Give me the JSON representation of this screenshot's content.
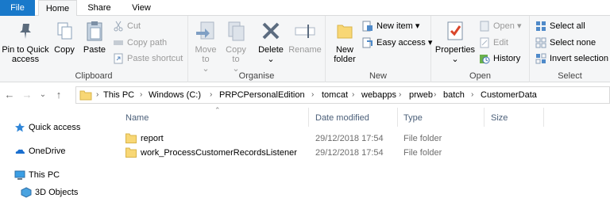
{
  "ribbon_tabs": {
    "file": "File",
    "home": "Home",
    "share": "Share",
    "view": "View"
  },
  "clipboard": {
    "pin": "Pin to Quick access",
    "copy": "Copy",
    "paste": "Paste",
    "cut": "Cut",
    "copy_path": "Copy path",
    "paste_shortcut": "Paste shortcut",
    "label": "Clipboard"
  },
  "organise": {
    "move_to": "Move to",
    "copy_to": "Copy to",
    "delete": "Delete",
    "rename": "Rename",
    "label": "Organise"
  },
  "new": {
    "new_folder": "New folder",
    "new_item": "New item",
    "easy_access": "Easy access",
    "label": "New"
  },
  "open": {
    "properties": "Properties",
    "open": "Open",
    "edit": "Edit",
    "history": "History",
    "label": "Open"
  },
  "select": {
    "select_all": "Select all",
    "select_none": "Select none",
    "invert": "Invert selection",
    "label": "Select"
  },
  "address": {
    "crumbs": [
      "This PC",
      "Windows (C:)",
      "PRPCPersonalEdition",
      "tomcat",
      "webapps",
      "prweb",
      "batch",
      "CustomerData"
    ]
  },
  "nav_pane": {
    "quick_access": "Quick access",
    "onedrive": "OneDrive",
    "this_pc": "This PC",
    "objects3d": "3D Objects"
  },
  "columns": {
    "name": "Name",
    "date": "Date modified",
    "type": "Type",
    "size": "Size"
  },
  "files": [
    {
      "name": "report",
      "date": "29/12/2018 17:54",
      "type": "File folder",
      "size": ""
    },
    {
      "name": "work_ProcessCustomerRecordsListener",
      "date": "29/12/2018 17:54",
      "type": "File folder",
      "size": ""
    }
  ],
  "colors": {
    "file_tab": "#1979ca",
    "ribbon_bg": "#f5f6f7",
    "folder": "#f8d775",
    "header_text": "#4c607a"
  }
}
